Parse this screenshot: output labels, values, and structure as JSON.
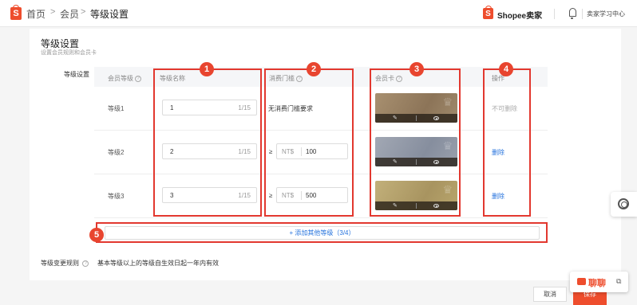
{
  "header": {
    "breadcrumb": [
      "首页",
      "会员",
      "等级设置"
    ],
    "separator": ">",
    "brand": "Shopee卖家",
    "learning_center": "卖家学习中心"
  },
  "page": {
    "title": "等级设置",
    "subtitle": "设置会员规则和会员卡"
  },
  "section_label": "等级设置",
  "table": {
    "headers": {
      "level": "会员等级",
      "name": "等级名称",
      "threshold": "消费门槛",
      "card": "会员卡",
      "action": "操作"
    },
    "rows": [
      {
        "level": "等级1",
        "name": "1",
        "count": "1/15",
        "threshold_text": "无消费门槛要求",
        "action": "不可删除",
        "action_color": "#aaaaaa",
        "card_color": "#a08a6c"
      },
      {
        "level": "等级2",
        "name": "2",
        "count": "1/15",
        "ge": "≥",
        "currency": "NT$",
        "amount": "100",
        "action": "删除",
        "action_color": "#2673dd",
        "card_color": "#9098a8"
      },
      {
        "level": "等级3",
        "name": "3",
        "count": "1/15",
        "ge": "≥",
        "currency": "NT$",
        "amount": "500",
        "action": "删除",
        "action_color": "#2673dd",
        "card_color": "#b8a56c"
      }
    ]
  },
  "add_level": "+ 添加其他等级（3/4）",
  "rules": {
    "label": "等级变更规则",
    "text": "基本等级以上的等级自生效日起一年内有效"
  },
  "footer": {
    "cancel": "取消",
    "save": "保存"
  },
  "chat": {
    "label": "聊聊"
  },
  "annotations": [
    "1",
    "2",
    "3",
    "4",
    "5"
  ],
  "colors": {
    "accent": "#ee4d2d",
    "annotation": "#e2382f",
    "link": "#2673dd"
  }
}
